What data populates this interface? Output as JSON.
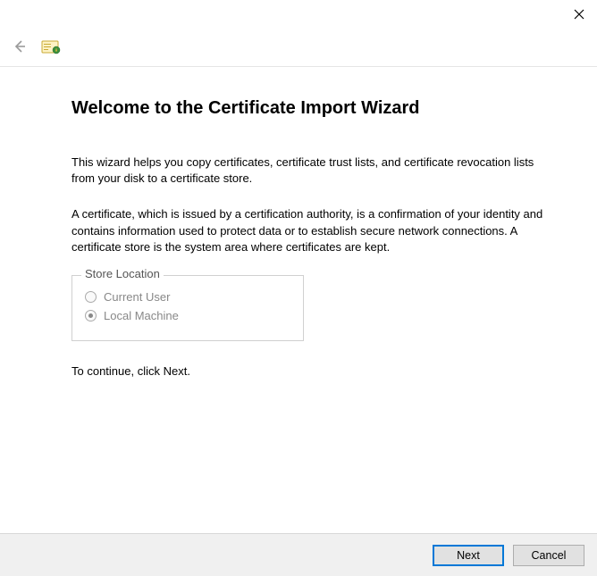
{
  "title": "Welcome to the Certificate Import Wizard",
  "intro": "This wizard helps you copy certificates, certificate trust lists, and certificate revocation lists from your disk to a certificate store.",
  "explanation": "A certificate, which is issued by a certification authority, is a confirmation of your identity and contains information used to protect data or to establish secure network connections. A certificate store is the system area where certificates are kept.",
  "storeLocation": {
    "legend": "Store Location",
    "options": [
      {
        "label": "Current User",
        "selected": false
      },
      {
        "label": "Local Machine",
        "selected": true
      }
    ]
  },
  "continueText": "To continue, click Next.",
  "buttons": {
    "next": "Next",
    "cancel": "Cancel"
  }
}
